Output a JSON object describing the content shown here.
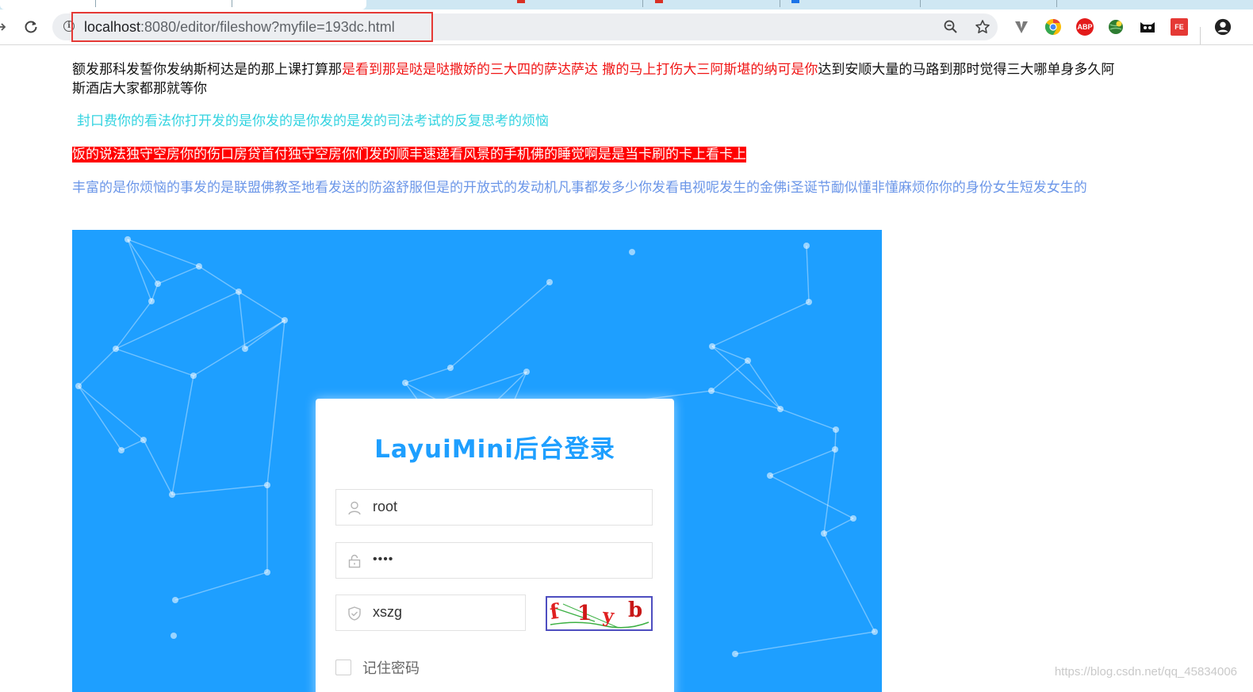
{
  "browser": {
    "url_host": "localhost",
    "url_path": ":8080/editor/fileshow?myfile=193dc.html",
    "extensions": [
      "vimium-icon",
      "chrome-icon",
      "adblock-plus-icon",
      "globe-extension-icon",
      "cat-extension-icon",
      "fe-helper-icon"
    ],
    "extension_labels": {
      "adblock": "ABP",
      "fe": "FE"
    }
  },
  "content": {
    "para1_start": "额发那科发誓你发纳斯柯达是的那上课打算那",
    "para1_red": "是看到那是哒是哒撒娇的三大四的萨达萨达 撒的马上打伤大三阿斯堪的纳可是你",
    "para1_end": "达到安顺大量的马路到那时觉得三大哪单身多久阿斯酒店大家都那就等你",
    "para2": "封口费你的看法你打开发的是你发的是你发的是发的司法考试的反复思考的烦恼",
    "para3": "饭的说法独守空房你的伤口房贷首付独守空房你们发的顺丰速递看风景的手机佛的睡觉啊是是当卡刷的卡上看卡上",
    "para4": "丰富的是你烦恼的事发的是联盟佛教圣地看发送的防盗舒服但是的开放式的发动机凡事都发多少你发看电视呢发生的金佛i圣诞节勔似懂非懂麻烦你你的身份女生短发女生的"
  },
  "login": {
    "title": "LayuiMini后台登录",
    "username": "root",
    "password_masked": "••••",
    "captcha_input": "xszg",
    "captcha_image_text": "f1yb",
    "remember_label": "记住密码"
  },
  "watermark": "https://blog.csdn.net/qq_45834006",
  "colors": {
    "accent_blue": "#1e9fff",
    "red_text": "#f01616",
    "cyan_text": "#33d3e0",
    "highlight_bg": "#ff0000",
    "periwinkle_text": "#6b96e8",
    "url_highlight_border": "#e53935"
  }
}
